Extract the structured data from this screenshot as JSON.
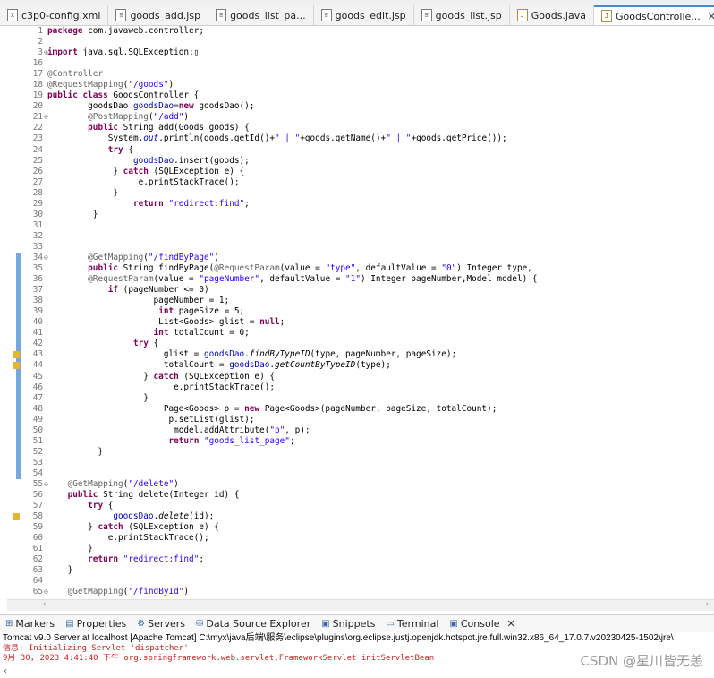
{
  "editor_tabs": [
    {
      "label": "c3p0-config.xml",
      "type": "xml"
    },
    {
      "label": "goods_add.jsp",
      "type": "jsp"
    },
    {
      "label": "goods_list_pa...",
      "type": "jsp"
    },
    {
      "label": "goods_edit.jsp",
      "type": "jsp"
    },
    {
      "label": "goods_list.jsp",
      "type": "jsp"
    },
    {
      "label": "Goods.java",
      "type": "java"
    },
    {
      "label": "GoodsControlle...",
      "type": "java",
      "active": true,
      "close": "✕"
    }
  ],
  "code_lines": [
    {
      "n": "1",
      "code": "<span class=\"kw\">package</span> com.javaweb.controller;"
    },
    {
      "n": "2",
      "code": ""
    },
    {
      "n": "3",
      "fold": "⊕",
      "code": "<span class=\"kw\">import</span> java.sql.SQLException;▯"
    },
    {
      "n": "16",
      "code": ""
    },
    {
      "n": "17",
      "code": "<span class=\"an\">@Controller</span>"
    },
    {
      "n": "18",
      "code": "<span class=\"an\">@RequestMapping</span>(<span class=\"str\">\"/goods\"</span>)"
    },
    {
      "n": "19",
      "code": "<span class=\"kw\">public class</span> GoodsController {"
    },
    {
      "n": "20",
      "code": "        goodsDao <span class=\"fld\">goodsDao</span>=<span class=\"kw\">new</span> goodsDao();"
    },
    {
      "n": "21",
      "fold": "⊖",
      "code": "        <span class=\"an\">@PostMapping</span>(<span class=\"str\">\"/add\"</span>)"
    },
    {
      "n": "22",
      "code": "        <span class=\"kw\">public</span> String add(Goods goods) {"
    },
    {
      "n": "23",
      "code": "            System.<span class=\"fld it\">out</span>.println(goods.getId()+<span class=\"str\">\" | \"</span>+goods.getName()+<span class=\"str\">\" | \"</span>+goods.getPrice());"
    },
    {
      "n": "24",
      "code": "            <span class=\"kw\">try</span> {"
    },
    {
      "n": "25",
      "code": "                 <span class=\"fld\">goodsDao</span>.insert(goods);"
    },
    {
      "n": "26",
      "code": "             } <span class=\"kw\">catch</span> (SQLException e) {"
    },
    {
      "n": "27",
      "code": "                  e.printStackTrace();"
    },
    {
      "n": "28",
      "code": "             }"
    },
    {
      "n": "29",
      "code": "                 <span class=\"kw\">return</span> <span class=\"str\">\"redirect:find\"</span>;"
    },
    {
      "n": "30",
      "code": "         }"
    },
    {
      "n": "31",
      "code": ""
    },
    {
      "n": "32",
      "code": ""
    },
    {
      "n": "33",
      "code": ""
    },
    {
      "n": "34",
      "fold": "⊖",
      "code": "        <span class=\"an\">@GetMapping</span>(<span class=\"str\">\"/findByPage\"</span>)"
    },
    {
      "n": "35",
      "code": "        <span class=\"kw\">public</span> String findByPage(<span class=\"an\">@RequestParam</span>(value = <span class=\"str\">\"type\"</span>, defaultValue = <span class=\"str\">\"0\"</span>) Integer type,"
    },
    {
      "n": "36",
      "code": "        <span class=\"an\">@RequestParam</span>(value = <span class=\"str\">\"pageNumber\"</span>, defaultValue = <span class=\"str\">\"1\"</span>) Integer pageNumber,Model model) {"
    },
    {
      "n": "37",
      "code": "            <span class=\"kw\">if</span> (pageNumber &lt;= 0)"
    },
    {
      "n": "38",
      "code": "                     pageNumber = 1;"
    },
    {
      "n": "39",
      "code": "                      <span class=\"kw\">int</span> pageSize = 5;"
    },
    {
      "n": "40",
      "code": "                      List&lt;Goods&gt; glist = <span class=\"kw\">null</span>;"
    },
    {
      "n": "41",
      "code": "                     <span class=\"kw\">int</span> totalCount = 0;"
    },
    {
      "n": "42",
      "code": "                 <span class=\"kw\">try</span> {"
    },
    {
      "n": "43",
      "warn": true,
      "code": "                       glist = <span class=\"fld\">goodsDao</span>.<span class=\"it\">findByTypeID</span>(type, pageNumber, pageSize);"
    },
    {
      "n": "44",
      "warn": true,
      "code": "                       totalCount = <span class=\"fld\">goodsDao</span>.<span class=\"it\">getCountByTypeID</span>(type);"
    },
    {
      "n": "45",
      "code": "                   } <span class=\"kw\">catch</span> (SQLException e) {"
    },
    {
      "n": "46",
      "code": "                         e.printStackTrace();"
    },
    {
      "n": "47",
      "code": "                   }"
    },
    {
      "n": "48",
      "code": "                       Page&lt;Goods&gt; p = <span class=\"kw\">new</span> Page&lt;Goods&gt;(pageNumber, pageSize, totalCount);"
    },
    {
      "n": "49",
      "code": "                        p.setList(glist);"
    },
    {
      "n": "50",
      "hl": true,
      "code": "                         model.addAttribute(<span class=\"str\">\"p\"</span>, p);"
    },
    {
      "n": "51",
      "code": "                        <span class=\"kw\">return</span> <span class=\"str\">\"goods_list_page\"</span>;"
    },
    {
      "n": "52",
      "code": "          }"
    },
    {
      "n": "53",
      "code": ""
    },
    {
      "n": "54",
      "code": ""
    },
    {
      "n": "55",
      "fold": "⊖",
      "code": "    <span class=\"an\">@GetMapping</span>(<span class=\"str\">\"/delete\"</span>)"
    },
    {
      "n": "56",
      "code": "    <span class=\"kw\">public</span> String delete(Integer id) {"
    },
    {
      "n": "57",
      "code": "        <span class=\"kw\">try</span> {"
    },
    {
      "n": "58",
      "warn": true,
      "code": "             <span class=\"fld\">goodsDao</span>.<span class=\"it\">delete</span>(id);"
    },
    {
      "n": "59",
      "code": "        } <span class=\"kw\">catch</span> (SQLException e) {"
    },
    {
      "n": "60",
      "code": "            e.printStackTrace();"
    },
    {
      "n": "61",
      "code": "        }"
    },
    {
      "n": "62",
      "code": "        <span class=\"kw\">return</span> <span class=\"str\">\"redirect:find\"</span>;"
    },
    {
      "n": "63",
      "code": "    }"
    },
    {
      "n": "64",
      "code": ""
    },
    {
      "n": "65",
      "fold": "⊖",
      "code": "    <span class=\"an\">@GetMapping</span>(<span class=\"str\">\"/findById\"</span>)"
    }
  ],
  "view_tabs": [
    {
      "label": "Markers",
      "icon": "⊞"
    },
    {
      "label": "Properties",
      "icon": "▤"
    },
    {
      "label": "Servers",
      "icon": "⚙"
    },
    {
      "label": "Data Source Explorer",
      "icon": "⛁"
    },
    {
      "label": "Snippets",
      "icon": "▣"
    },
    {
      "label": "Terminal",
      "icon": "▭"
    },
    {
      "label": "Console",
      "icon": "▣",
      "active": true,
      "close": "✕"
    }
  ],
  "console": {
    "header": "Tomcat v9.0 Server at localhost [Apache Tomcat] C:\\myx\\java后端\\服务\\eclipse\\plugins\\org.eclipse.justj.openjdk.hotspot.jre.full.win32.x86_64_17.0.7.v20230425-1502\\jre\\",
    "lines": [
      "信息: Initializing Servlet 'dispatcher'",
      "9月 30, 2023 4:41:40 下午 org.springframework.web.servlet.FrameworkServlet initServletBean"
    ]
  },
  "watermark": "CSDN @星川皆无恙"
}
